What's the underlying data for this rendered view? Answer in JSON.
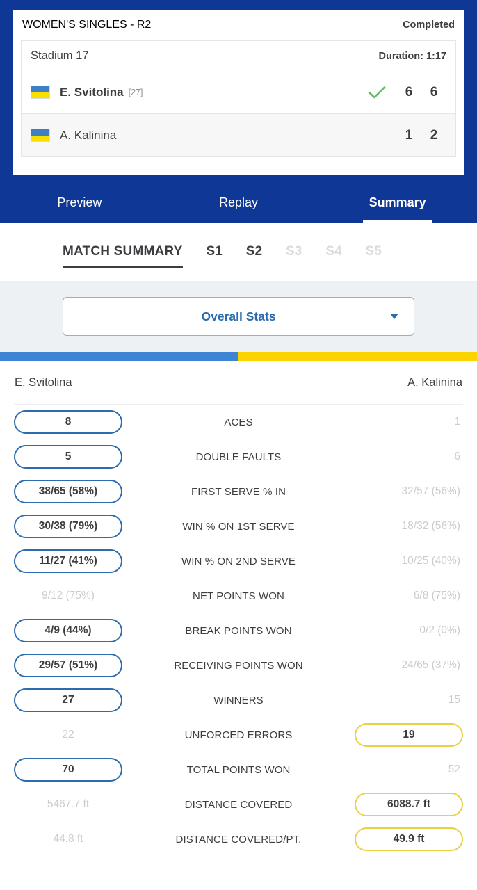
{
  "scoreboard": {
    "event_title": "WOMEN'S SINGLES - R2",
    "status": "Completed",
    "venue": "Stadium 17",
    "duration": "Duration: 1:17",
    "players": [
      {
        "name": "E. Svitolina",
        "seed": "[27]",
        "winner_icon": "check-icon",
        "sets": [
          "6",
          "6"
        ],
        "flag": "ukraine-flag"
      },
      {
        "name": "A. Kalinina",
        "seed": "",
        "winner_icon": "",
        "sets": [
          "1",
          "2"
        ],
        "flag": "ukraine-flag"
      }
    ]
  },
  "nav_tabs": [
    {
      "label": "Preview",
      "active": false
    },
    {
      "label": "Replay",
      "active": false
    },
    {
      "label": "Summary",
      "active": true
    }
  ],
  "set_tabs": [
    {
      "label": "MATCH SUMMARY",
      "state": "active"
    },
    {
      "label": "S1",
      "state": "enabled"
    },
    {
      "label": "S2",
      "state": "enabled"
    },
    {
      "label": "S3",
      "state": "disabled"
    },
    {
      "label": "S4",
      "state": "disabled"
    },
    {
      "label": "S5",
      "state": "disabled"
    }
  ],
  "dropdown": {
    "label": "Overall Stats",
    "caret_icon": "chevron-down-icon"
  },
  "split_bar": {
    "left_color": "#3d85d4",
    "right_color": "#fbd400",
    "left_pct": 50
  },
  "stats_header": {
    "player_left": "E. Svitolina",
    "player_right": "A. Kalinina"
  },
  "colors": {
    "navy": "#0f3896",
    "accent_blue": "#2b6cae",
    "accent_yellow": "#e9d143",
    "muted": "#c9ccd0",
    "text": "#3b3d40"
  },
  "stats_rows": [
    {
      "label": "ACES",
      "left": "8",
      "right": "1",
      "leader": "left"
    },
    {
      "label": "DOUBLE FAULTS",
      "left": "5",
      "right": "6",
      "leader": "left"
    },
    {
      "label": "FIRST SERVE % IN",
      "left": "38/65 (58%)",
      "right": "32/57 (56%)",
      "leader": "left"
    },
    {
      "label": "WIN % ON 1ST SERVE",
      "left": "30/38 (79%)",
      "right": "18/32 (56%)",
      "leader": "left"
    },
    {
      "label": "WIN % ON 2ND SERVE",
      "left": "11/27 (41%)",
      "right": "10/25 (40%)",
      "leader": "left"
    },
    {
      "label": "NET POINTS WON",
      "left": "9/12 (75%)",
      "right": "6/8 (75%)",
      "leader": "none"
    },
    {
      "label": "BREAK POINTS WON",
      "left": "4/9 (44%)",
      "right": "0/2 (0%)",
      "leader": "left"
    },
    {
      "label": "RECEIVING POINTS WON",
      "left": "29/57 (51%)",
      "right": "24/65 (37%)",
      "leader": "left"
    },
    {
      "label": "WINNERS",
      "left": "27",
      "right": "15",
      "leader": "left"
    },
    {
      "label": "UNFORCED ERRORS",
      "left": "22",
      "right": "19",
      "leader": "right"
    },
    {
      "label": "TOTAL POINTS WON",
      "left": "70",
      "right": "52",
      "leader": "left"
    },
    {
      "label": "DISTANCE COVERED",
      "left": "5467.7 ft",
      "right": "6088.7 ft",
      "leader": "right"
    },
    {
      "label": "DISTANCE COVERED/PT.",
      "left": "44.8 ft",
      "right": "49.9 ft",
      "leader": "right"
    }
  ]
}
